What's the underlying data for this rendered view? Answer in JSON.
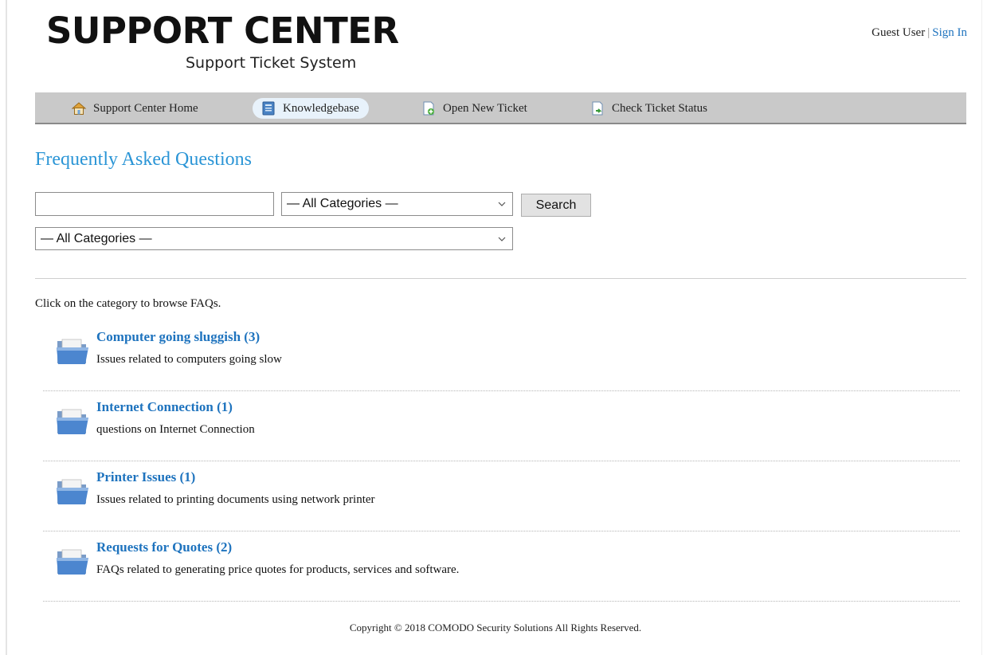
{
  "header": {
    "logo_title": "SUPPORT CENTER",
    "logo_subtitle": "Support Ticket System",
    "user": "Guest User",
    "separator": "|",
    "sign_in": "Sign In"
  },
  "nav": {
    "items": [
      {
        "label": "Support Center Home",
        "icon": "home-icon"
      },
      {
        "label": "Knowledgebase",
        "icon": "book-icon",
        "active": true
      },
      {
        "label": "Open New Ticket",
        "icon": "new-ticket-icon"
      },
      {
        "label": "Check Ticket Status",
        "icon": "ticket-status-icon"
      }
    ]
  },
  "main": {
    "title": "Frequently Asked Questions",
    "search_value": "",
    "category_select": "— All Categories —",
    "topic_select": "— All Categories —",
    "search_button": "Search",
    "browse_text": "Click on the category to browse FAQs."
  },
  "categories": [
    {
      "title": "Computer going sluggish (3)",
      "description": "Issues related to computers going slow"
    },
    {
      "title": "Internet Connection (1)",
      "description": "questions on Internet Connection"
    },
    {
      "title": "Printer Issues (1)",
      "description": "Issues related to printing documents using network printer"
    },
    {
      "title": "Requests for Quotes (2)",
      "description": "FAQs related to generating price quotes for products, services and software."
    }
  ],
  "footer": {
    "copyright": "Copyright © 2018 COMODO Security Solutions All Rights Reserved."
  },
  "colors": {
    "link": "#1e73be",
    "title": "#2b95d6",
    "nav_bg": "#c9c9c9",
    "nav_active": "#e8f2fb"
  }
}
